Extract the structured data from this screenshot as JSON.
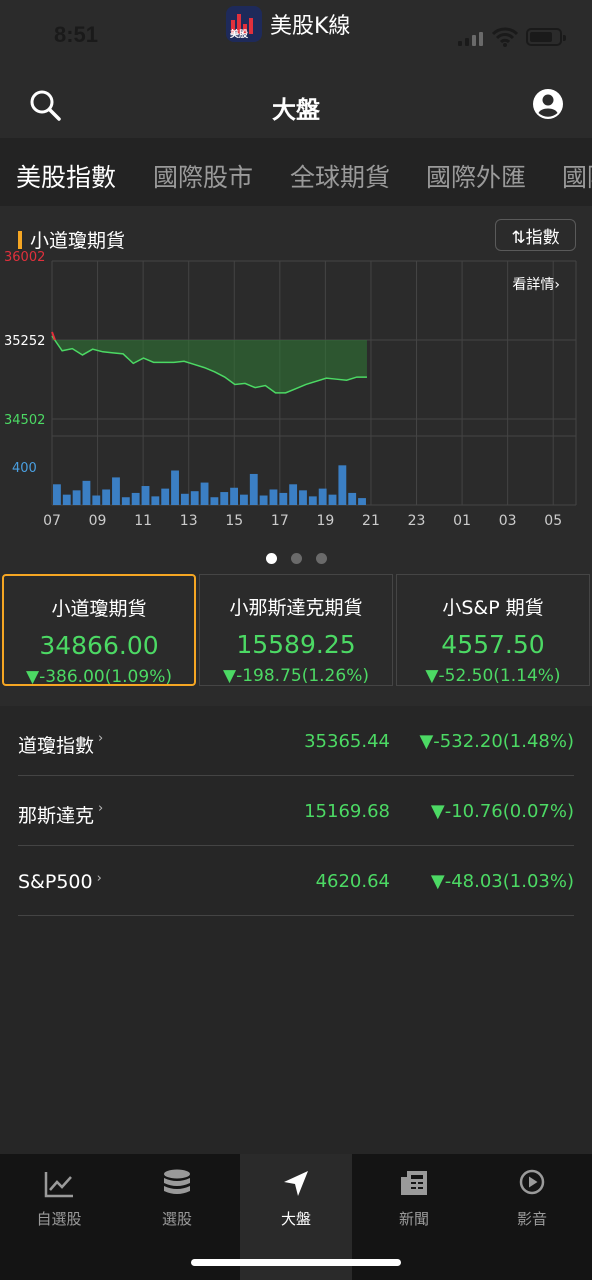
{
  "status_bar": {
    "time": "8:51",
    "app_name": "美股K線",
    "app_logo_text": "美股"
  },
  "nav": {
    "title": "大盤",
    "search_icon": "search-icon",
    "user_icon": "user-icon"
  },
  "tabs": [
    "美股指數",
    "國際股市",
    "全球期貨",
    "國際外匯",
    "國際"
  ],
  "chart": {
    "section_title": "小道瓊期貨",
    "toggle_label": "⇅指數",
    "detail_link": "看詳情›",
    "volume_label": "400",
    "accent_color": "#f5a623",
    "up_color": "#e0303c",
    "down_color": "#4cd964"
  },
  "chart_data": {
    "type": "line",
    "title": "小道瓊期貨",
    "y_ticks": [
      "36002",
      "35252",
      "34502"
    ],
    "ylim": [
      34502,
      36002
    ],
    "reference": 35252,
    "x_ticks": [
      "07",
      "09",
      "11",
      "13",
      "15",
      "17",
      "19",
      "21",
      "23",
      "01",
      "03",
      "05"
    ],
    "series": [
      {
        "values": [
          35290,
          35150,
          35170,
          35110,
          35165,
          35140,
          35130,
          35120,
          35030,
          35080,
          35040,
          35040,
          35040,
          35050,
          35020,
          34990,
          34950,
          34900,
          34830,
          34840,
          34800,
          34820,
          34750,
          34750,
          34790,
          34830,
          34860,
          34890,
          34880,
          34870,
          34900,
          34900
        ]
      }
    ],
    "volume": [
      120,
      60,
      85,
      140,
      55,
      90,
      160,
      45,
      70,
      110,
      50,
      95,
      200,
      65,
      80,
      130,
      45,
      75,
      100,
      60,
      180,
      55,
      90,
      70,
      120,
      85,
      50,
      95,
      60,
      230,
      70,
      40
    ],
    "volume_max_label": "400",
    "grid": true
  },
  "pager": {
    "count": 3,
    "active": 0
  },
  "futures": [
    {
      "name": "小道瓊期貨",
      "price": "34866.00",
      "change": "▼-386.00(1.09%)"
    },
    {
      "name": "小那斯達克期貨",
      "price": "15589.25",
      "change": "▼-198.75(1.26%)"
    },
    {
      "name": "小S&P 期貨",
      "price": "4557.50",
      "change": "▼-52.50(1.14%)"
    }
  ],
  "indices": [
    {
      "name": "道瓊指數",
      "value": "35365.44",
      "change": "▼-532.20(1.48%)"
    },
    {
      "name": "那斯達克",
      "value": "15169.68",
      "change": "▼-10.76(0.07%)"
    },
    {
      "name": "S&P500",
      "value": "4620.64",
      "change": "▼-48.03(1.03%)"
    }
  ],
  "tabbar": [
    {
      "label": "自選股",
      "icon": "chart-trend-icon"
    },
    {
      "label": "選股",
      "icon": "database-stack-icon"
    },
    {
      "label": "大盤",
      "icon": "navigation-arrow-icon"
    },
    {
      "label": "新聞",
      "icon": "newspaper-icon"
    },
    {
      "label": "影音",
      "icon": "play-circle-icon"
    }
  ],
  "tabbar_active": 2
}
